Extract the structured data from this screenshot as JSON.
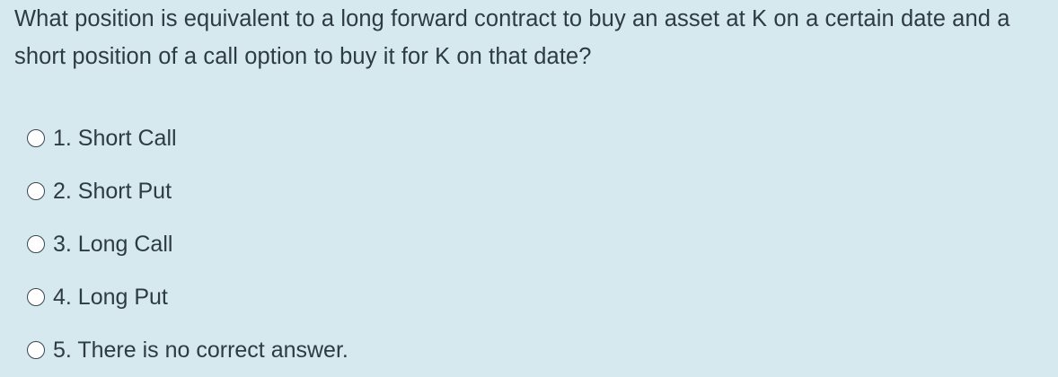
{
  "question": {
    "text": "What position is equivalent to a long forward contract to buy an asset at K on a certain date and a short position of a call option to buy it for K on that date?"
  },
  "answers": [
    {
      "label": "1. Short Call"
    },
    {
      "label": "2. Short Put"
    },
    {
      "label": "3. Long Call"
    },
    {
      "label": "4. Long Put"
    },
    {
      "label": "5. There is no correct answer."
    }
  ],
  "colors": {
    "background": "#d6e9ee",
    "text": "#2d3b45",
    "radio_border": "#3a4650",
    "radio_fill": "#ffffff"
  }
}
